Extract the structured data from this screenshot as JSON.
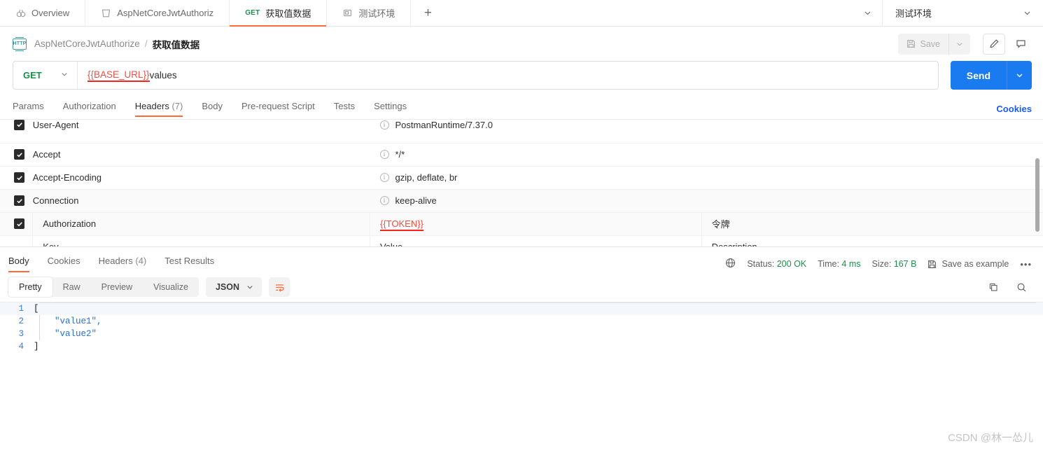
{
  "topbar": {
    "tabs": [
      {
        "label": "Overview",
        "icon": "overview-icon",
        "method": "",
        "active": false
      },
      {
        "label": "AspNetCoreJwtAuthoriz",
        "icon": "collection-icon",
        "method": "",
        "active": false
      },
      {
        "label": "获取值数据",
        "icon": "",
        "method": "GET",
        "active": true
      },
      {
        "label": "测试环境",
        "icon": "environment-icon",
        "method": "",
        "active": false
      }
    ],
    "new_tab_label": "+",
    "tabs_chevron": "⌄",
    "environment": {
      "name": "测试环境",
      "chevron": "⌄"
    }
  },
  "breadcrumb": {
    "badge": "HTTP",
    "parent": "AspNetCoreJwtAuthorize",
    "separator": "/",
    "current": "获取值数据",
    "save_label": "Save",
    "save_caret": "⌄",
    "edit_icon": "pencil-icon",
    "comment_icon": "comment-icon"
  },
  "request": {
    "method": "GET",
    "method_caret": "⌄",
    "url_variable": "{{BASE_URL}}",
    "url_rest": "values",
    "send_label": "Send",
    "send_caret": "⌄",
    "tabs": [
      {
        "label": "Params",
        "count": "",
        "active": false
      },
      {
        "label": "Authorization",
        "count": "",
        "active": false
      },
      {
        "label": "Headers",
        "count": "(7)",
        "active": true
      },
      {
        "label": "Body",
        "count": "",
        "active": false
      },
      {
        "label": "Pre-request Script",
        "count": "",
        "active": false
      },
      {
        "label": "Tests",
        "count": "",
        "active": false
      },
      {
        "label": "Settings",
        "count": "",
        "active": false
      }
    ],
    "cookies_link": "Cookies"
  },
  "headers_table": {
    "placeholders": {
      "key": "Key",
      "value": "Value",
      "description": "Description"
    },
    "rows": [
      {
        "checked": true,
        "key": "User-Agent",
        "value": "PostmanRuntime/7.37.0",
        "description": "",
        "info": true,
        "variable": false
      },
      {
        "checked": true,
        "key": "Accept",
        "value": "*/*",
        "description": "",
        "info": true,
        "variable": false
      },
      {
        "checked": true,
        "key": "Accept-Encoding",
        "value": "gzip, deflate, br",
        "description": "",
        "info": true,
        "variable": false
      },
      {
        "checked": true,
        "key": "Connection",
        "value": "keep-alive",
        "description": "",
        "info": true,
        "variable": false
      },
      {
        "checked": true,
        "key": "Authorization",
        "value": "{{TOKEN}}",
        "description": "令牌",
        "info": false,
        "variable": true
      }
    ]
  },
  "response": {
    "tabs": [
      {
        "label": "Body",
        "count": "",
        "active": true
      },
      {
        "label": "Cookies",
        "count": "",
        "active": false
      },
      {
        "label": "Headers",
        "count": "(4)",
        "active": false
      },
      {
        "label": "Test Results",
        "count": "",
        "active": false
      }
    ],
    "globe_icon": "globe-icon",
    "status_label": "Status:",
    "status_value": "200 OK",
    "time_label": "Time:",
    "time_value": "4 ms",
    "size_label": "Size:",
    "size_value": "167 B",
    "save_example_label": "Save as example",
    "more_label": "•••",
    "format_tabs": [
      {
        "label": "Pretty",
        "active": true
      },
      {
        "label": "Raw",
        "active": false
      },
      {
        "label": "Preview",
        "active": false
      },
      {
        "label": "Visualize",
        "active": false
      }
    ],
    "language": "JSON",
    "language_caret": "⌄",
    "wrap_icon": "wrap-text-icon",
    "copy_icon": "copy-icon",
    "search_icon": "search-icon",
    "body_lines": [
      {
        "num": "1",
        "text": "[",
        "quoted": ""
      },
      {
        "num": "2",
        "text": "    ",
        "quoted": "\"value1\","
      },
      {
        "num": "3",
        "text": "    ",
        "quoted": "\"value2\""
      },
      {
        "num": "4",
        "text": "]",
        "quoted": ""
      }
    ]
  },
  "watermark": "CSDN @林一怂儿",
  "colors": {
    "accent_orange": "#ff6c37",
    "send_blue": "#1a7bf0",
    "method_green": "#1a8f4a",
    "variable_red": "#f04e43",
    "link_blue": "#1a5cf0"
  }
}
